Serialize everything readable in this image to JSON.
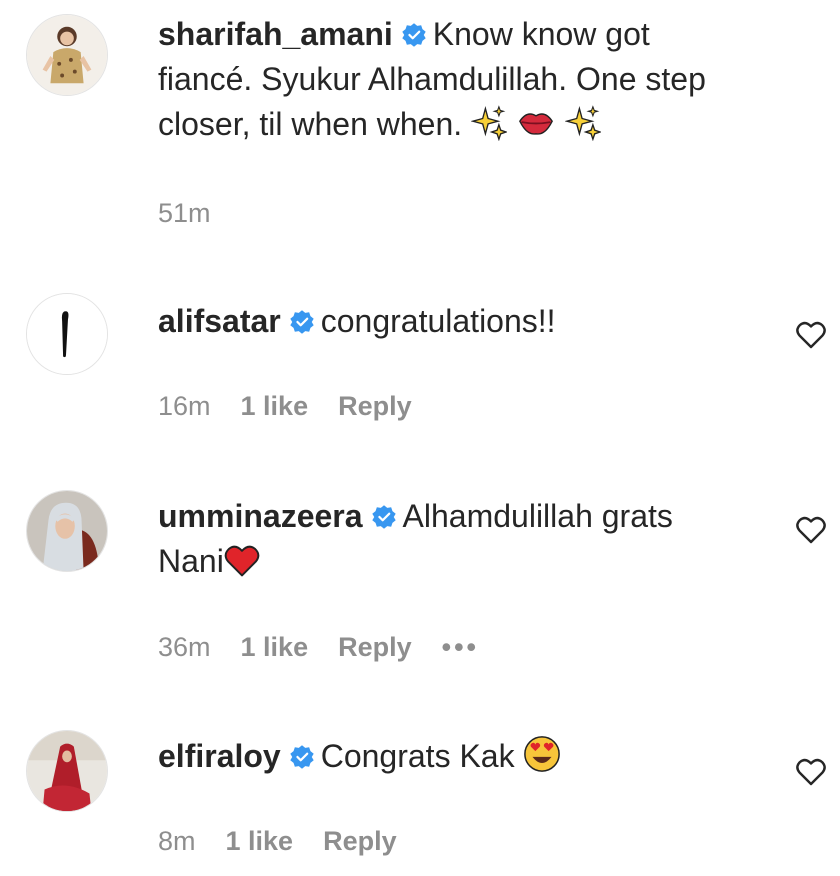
{
  "caption": {
    "username": "sharifah_amani",
    "text_line1": "Know know got",
    "text_line2": "fiancé. Syukur Alhamdulillah. One step",
    "text_line3": "closer, til when when.",
    "time": "51m"
  },
  "comments": [
    {
      "username": "alifsatar",
      "text": "congratulations!!",
      "time": "16m",
      "likes": "1 like",
      "reply": "Reply"
    },
    {
      "username": "umminazeera",
      "text_line1": "Alhamdulillah grats",
      "text_line2": "Nani",
      "time": "36m",
      "likes": "1 like",
      "reply": "Reply",
      "more": "•••"
    },
    {
      "username": "elfiraloy",
      "text": "Congrats Kak",
      "time": "8m",
      "likes": "1 like",
      "reply": "Reply"
    }
  ],
  "colors": {
    "text": "#262626",
    "meta": "#8e8e8e",
    "verified": "#3897f0",
    "heart_red": "#e0242a"
  },
  "icons": [
    "verified-badge-icon",
    "sparkles-emoji",
    "lips-emoji",
    "red-heart-emoji",
    "heart-eyes-emoji",
    "like-heart-icon"
  ]
}
